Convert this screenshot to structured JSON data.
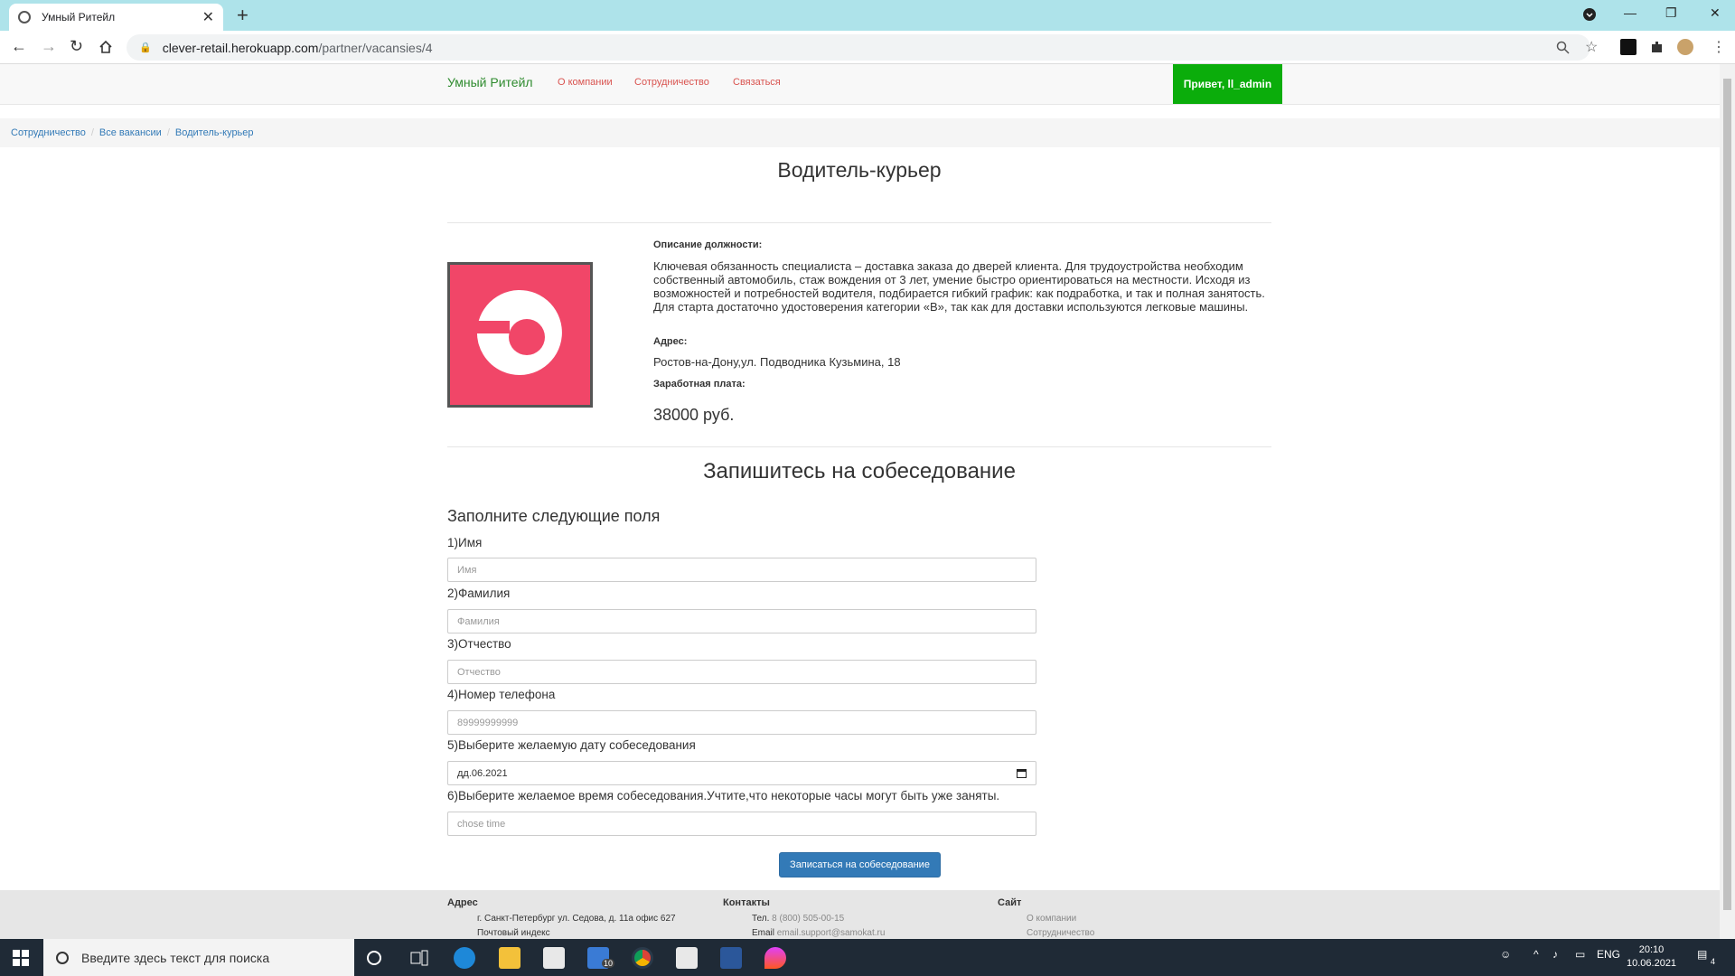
{
  "browser": {
    "tab_title": "Умный Ритейл",
    "tab_close": "✕",
    "new_tab": "+",
    "url_host": "clever-retail.herokuapp.com",
    "url_path": "/partner/vacansies/4",
    "window_controls": [
      "—",
      "❐",
      "✕"
    ]
  },
  "site": {
    "brand": "Умный Ритейл",
    "nav": [
      "О компании",
      "Сотрудничество",
      "Связаться"
    ],
    "greeting": "Привет, ll_admin"
  },
  "breadcrumb": [
    "Сотрудничество",
    "Все вакансии",
    "Водитель-курьер"
  ],
  "vacancy": {
    "title": "Водитель-курьер",
    "description_label": "Описание должности:",
    "description": "Ключевая обязанность специалиста – доставка заказа до дверей клиента. Для трудоустройства необходим собственный автомобиль, стаж вождения от 3 лет, умение быстро ориентироваться на местности. Исходя из возможностей и потребностей водителя, подбирается гибкий график: как подработка, и так и полная занятость. Для старта достаточно удостоверения категории «В», так как для доставки используются легковые машины.",
    "address_label": "Адрес:",
    "address": "Ростов-на-Дону,ул. Подводника Кузьмина, 18",
    "salary_label": "Заработная плата:",
    "salary": "38000 руб."
  },
  "form": {
    "heading": "Запишитесь на собеседование",
    "subheading": "Заполните следующие поля",
    "fields": [
      {
        "label": "1)Имя",
        "placeholder": "Имя",
        "value": ""
      },
      {
        "label": "2)Фамилия",
        "placeholder": "Фамилия",
        "value": ""
      },
      {
        "label": "3)Отчество",
        "placeholder": "Отчество",
        "value": ""
      },
      {
        "label": "4)Номер телефона",
        "placeholder": "89999999999",
        "value": ""
      },
      {
        "label": "5)Выберите желаемую дату собеседования",
        "placeholder": "",
        "value": "дд.06.2021"
      },
      {
        "label": "6)Выберите желаемое время собеседования.Учтите,что некоторые часы могут быть уже заняты.",
        "placeholder": "chose time",
        "value": ""
      }
    ],
    "submit_label": "Записаться на собеседование"
  },
  "footer": {
    "address_heading": "Адрес",
    "address_line1": "г. Санкт-Петербург ул. Седова, д. 11а офис 627",
    "address_line2": "Почтовый индекс",
    "contacts_heading": "Контакты",
    "phone_label": "Тел.",
    "phone": "8 (800) 505-00-15",
    "email_label": "Email",
    "email": "email.support@samokat.ru",
    "site_heading": "Сайт",
    "site_link1": "О компании",
    "site_link2": "Сотрудничество"
  },
  "taskbar": {
    "search_placeholder": "Введите здесь текст для поиска",
    "mail_badge": "10",
    "lang": "ENG",
    "time": "20:10",
    "date": "10.06.2021",
    "notif_badge": "4"
  },
  "colors": {
    "brand_green": "#2e8b2e",
    "greet_bg": "#0bad0b",
    "nav_link": "#d9534f",
    "link_blue": "#337ab7",
    "logo_pink": "#f14668"
  }
}
